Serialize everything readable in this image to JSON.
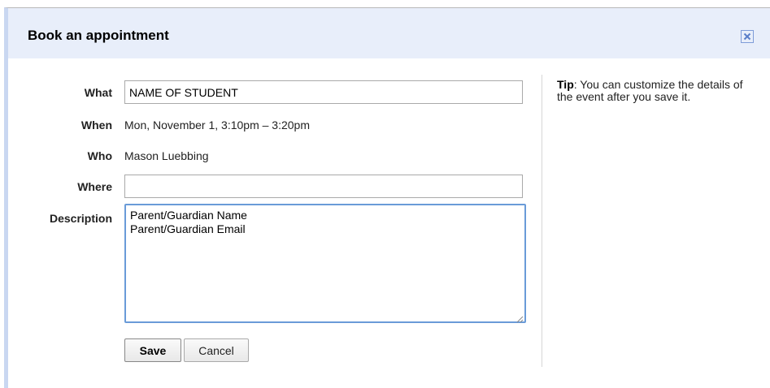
{
  "dialog": {
    "title": "Book an appointment",
    "close_icon": "close-icon"
  },
  "form": {
    "what_label": "What",
    "what_value": "NAME OF STUDENT",
    "when_label": "When",
    "when_value": "Mon, November 1, 3:10pm – 3:20pm",
    "who_label": "Who",
    "who_value": "Mason Luebbing",
    "where_label": "Where",
    "where_value": "",
    "description_label": "Description",
    "description_value": "Parent/Guardian Name\nParent/Guardian Email"
  },
  "buttons": {
    "save_label": "Save",
    "cancel_label": "Cancel"
  },
  "tip": {
    "title": "Tip",
    "text": ": You can customize the details of the event after you save it."
  },
  "colors": {
    "titlebar_bg": "#e8eefa",
    "focus_border": "#6a9bd8",
    "close_border": "#7e9cd8",
    "close_x": "#5a7ec9"
  }
}
